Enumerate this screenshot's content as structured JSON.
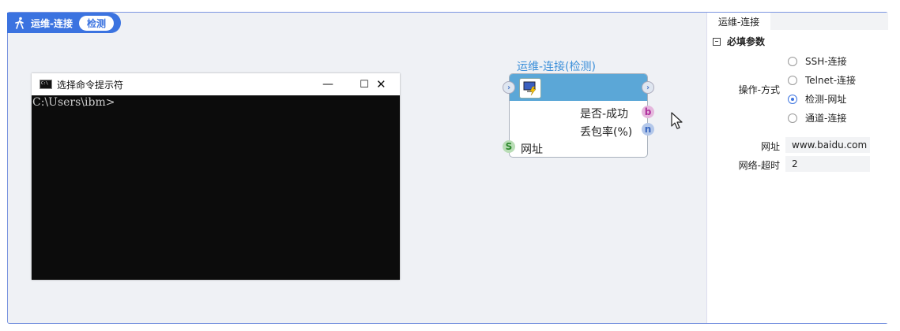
{
  "header": {
    "title": "运维-连接",
    "badge": "检测"
  },
  "console": {
    "title": "选择命令提示符",
    "minimize": "—",
    "maximize": "☐",
    "close": "✕",
    "prompt": "C:\\Users\\ibm>"
  },
  "node": {
    "title": "运维-连接(检测)",
    "outputs": [
      {
        "label": "是否-成功",
        "port": "b"
      },
      {
        "label": "丢包率(%)",
        "port": "n"
      }
    ],
    "inputs": [
      {
        "label": "网址",
        "port": "S"
      }
    ]
  },
  "panel": {
    "tab": "运维-连接",
    "section": "必填参数",
    "operation_label": "操作-方式",
    "options": [
      "SSH-连接",
      "Telnet-连接",
      "检测-网址",
      "通道-连接"
    ],
    "selected_option": "检测-网址",
    "fields": [
      {
        "label": "网址",
        "value": "www.baidu.com"
      },
      {
        "label": "网络-超时",
        "value": "2"
      }
    ]
  },
  "colors": {
    "accent": "#3b73e0",
    "node_header": "#5ba7d7",
    "node_title": "#3b8fd9"
  }
}
